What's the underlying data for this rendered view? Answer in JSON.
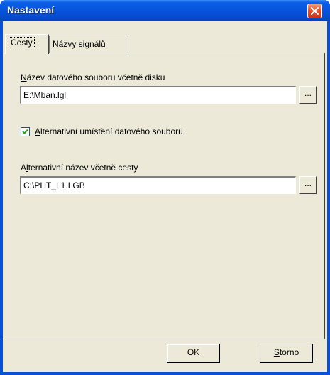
{
  "window": {
    "title": "Nastavení",
    "colors": {
      "titlebar": "#0754dd",
      "face": "#ece9d8",
      "close": "#e2552f"
    }
  },
  "tabs": [
    {
      "label": "Cesty",
      "active": true
    },
    {
      "label": "Názvy signálů",
      "active": false
    }
  ],
  "data_file": {
    "label_access": "N",
    "label_rest": "ázev datového souboru včetně disku",
    "value": "E:\\Mban.lgl",
    "browse_label": "..."
  },
  "alt_location": {
    "checked": true,
    "label_access": "A",
    "label_rest": "lternativní umístění datového souboru"
  },
  "alt_name": {
    "label_prefix": "A",
    "label_access": "l",
    "label_rest": "ternativní název včetně cesty",
    "value": "C:\\PHT_L1.LGB",
    "browse_label": "..."
  },
  "buttons": {
    "ok": "OK",
    "cancel_access": "S",
    "cancel_rest": "torno"
  }
}
